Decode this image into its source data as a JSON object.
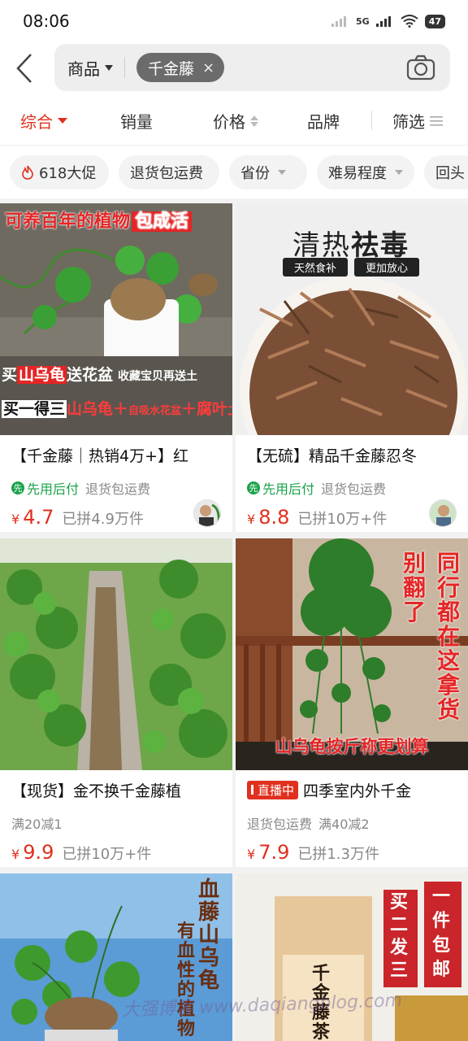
{
  "status": {
    "time": "08:06",
    "network": "5G",
    "battery": "47"
  },
  "search": {
    "category": "商品",
    "keyword": "千金藤",
    "clear": "×"
  },
  "sort": {
    "items": [
      "综合",
      "销量",
      "价格",
      "品牌",
      "筛选"
    ]
  },
  "filters": [
    "618大促",
    "退货包运费",
    "省份",
    "难易程度",
    "回头"
  ],
  "products": [
    {
      "title": "【千金藤｜热销4万+】红",
      "tag1": "先用后付",
      "tag2": "退货包运费",
      "currency": "¥",
      "price": "4.7",
      "sold": "已拼4.9万件",
      "img_text": {
        "line1": "可养百年的植物",
        "badge": "包成活",
        "line2a": "买",
        "line2b": "山乌龟",
        "line2c": "送花盆",
        "line2d": "收藏宝贝再送土",
        "line3a": "买一得三",
        "line3b": "山乌龟＋",
        "line3c": "自吸水花盆",
        "line3d": "＋腐叶土"
      }
    },
    {
      "title": "【无硫】精品千金藤忍冬",
      "tag1": "先用后付",
      "tag2": "退货包运费",
      "currency": "¥",
      "price": "8.8",
      "sold": "已拼10万+件",
      "img_text": {
        "heading_a": "清热",
        "heading_b": "祛毒",
        "pill1": "天然食补",
        "pill2": "更加放心"
      }
    },
    {
      "title": "【现货】金不换千金藤植",
      "tag1": "满20减1",
      "currency": "¥",
      "price": "9.9",
      "sold": "已拼10万+件"
    },
    {
      "title": "四季室内外千金",
      "live": "直播中",
      "tag1": "退货包运费",
      "tag2": "满40减2",
      "currency": "¥",
      "price": "7.9",
      "sold": "已拼1.3万件",
      "img_text": {
        "v1": "别翻了",
        "v2": "同行都在这拿货",
        "bottom": "山乌龟按斤称更划算"
      }
    },
    {
      "img_text": {
        "v1": "血藤山乌龟",
        "v2": "有血性的植物"
      }
    },
    {
      "img_text": {
        "box": "千金藤茶",
        "t1": "买二发三",
        "t2": "一件包邮"
      }
    }
  ],
  "watermark": "大强博客 www.daqiangblog.com"
}
